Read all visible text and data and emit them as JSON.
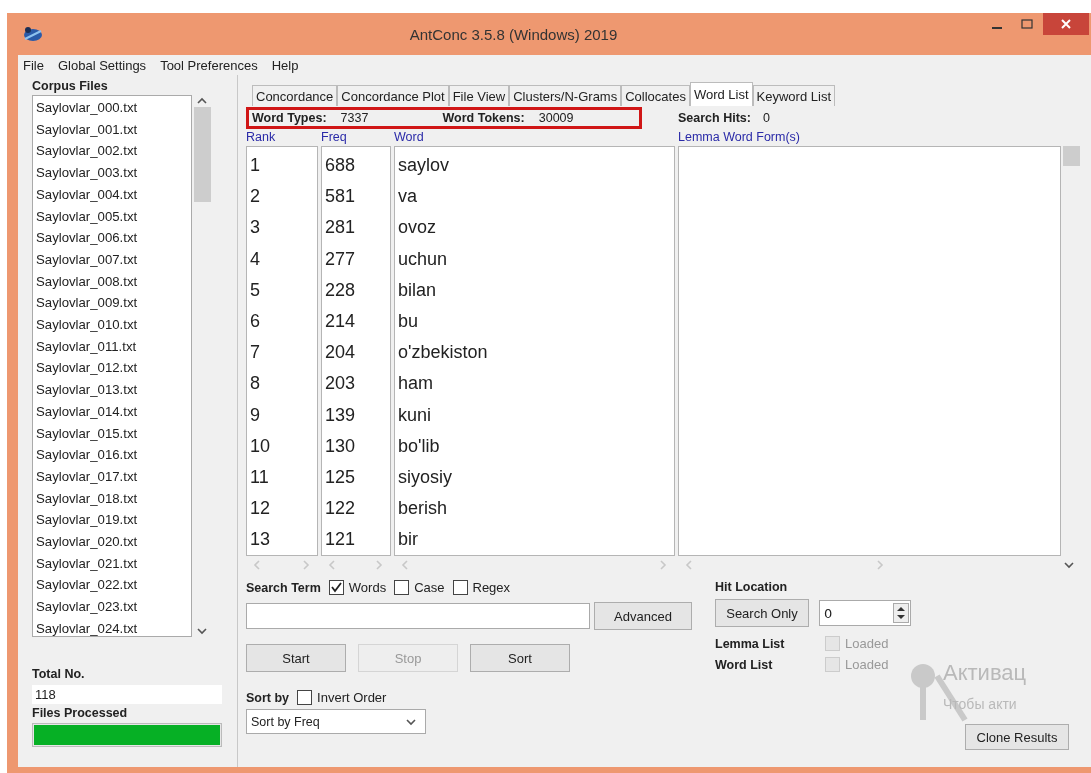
{
  "window": {
    "title": "AntConc 3.5.8 (Windows) 2019"
  },
  "menu": [
    "File",
    "Global Settings",
    "Tool Preferences",
    "Help"
  ],
  "corpus": {
    "label": "Corpus Files",
    "files": [
      "Saylovlar_000.txt",
      "Saylovlar_001.txt",
      "Saylovlar_002.txt",
      "Saylovlar_003.txt",
      "Saylovlar_004.txt",
      "Saylovlar_005.txt",
      "Saylovlar_006.txt",
      "Saylovlar_007.txt",
      "Saylovlar_008.txt",
      "Saylovlar_009.txt",
      "Saylovlar_010.txt",
      "Saylovlar_011.txt",
      "Saylovlar_012.txt",
      "Saylovlar_013.txt",
      "Saylovlar_014.txt",
      "Saylovlar_015.txt",
      "Saylovlar_016.txt",
      "Saylovlar_017.txt",
      "Saylovlar_018.txt",
      "Saylovlar_019.txt",
      "Saylovlar_020.txt",
      "Saylovlar_021.txt",
      "Saylovlar_022.txt",
      "Saylovlar_023.txt",
      "Saylovlar_024.txt"
    ],
    "total_label": "Total No.",
    "total": "118",
    "processed_label": "Files Processed",
    "progress": {
      "level": 1
    }
  },
  "tabs": [
    {
      "label": "Concordance",
      "selected": false
    },
    {
      "label": "Concordance Plot",
      "selected": false
    },
    {
      "label": "File View",
      "selected": false
    },
    {
      "label": "Clusters/N-Grams",
      "selected": false
    },
    {
      "label": "Collocates",
      "selected": false
    },
    {
      "label": "Word List",
      "selected": true
    },
    {
      "label": "Keyword List",
      "selected": false
    }
  ],
  "stats": {
    "word_types_label": "Word Types:",
    "word_types": "7337",
    "word_tokens_label": "Word Tokens:",
    "word_tokens": "30009",
    "search_hits_label": "Search Hits:",
    "search_hits": "0"
  },
  "table": {
    "columns": [
      "Rank",
      "Freq",
      "Word"
    ],
    "rows": [
      [
        "1",
        "688",
        "saylov"
      ],
      [
        "2",
        "581",
        "va"
      ],
      [
        "3",
        "281",
        "ovoz"
      ],
      [
        "4",
        "277",
        "uchun"
      ],
      [
        "5",
        "228",
        "bilan"
      ],
      [
        "6",
        "214",
        "bu"
      ],
      [
        "7",
        "204",
        "o'zbekiston"
      ],
      [
        "8",
        "203",
        "ham"
      ],
      [
        "9",
        "139",
        "kuni"
      ],
      [
        "10",
        "130",
        "bo'lib"
      ],
      [
        "11",
        "125",
        "siyosiy"
      ],
      [
        "12",
        "122",
        "berish"
      ],
      [
        "13",
        "121",
        "bir"
      ]
    ]
  },
  "lemma_panel": {
    "heading": "Lemma Word Form(s)"
  },
  "search": {
    "label": "Search Term",
    "options": [
      {
        "label": "Words",
        "checked": true
      },
      {
        "label": "Case",
        "checked": false
      },
      {
        "label": "Regex",
        "checked": false
      }
    ],
    "advanced": "Advanced"
  },
  "buttons": [
    {
      "label": "Start",
      "disabled": false
    },
    {
      "label": "Stop",
      "disabled": true
    },
    {
      "label": "Sort",
      "disabled": false
    }
  ],
  "sort": {
    "label": "Sort by",
    "invert": {
      "label": "Invert Order",
      "checked": false
    },
    "value": "Sort by Freq"
  },
  "hit_location": {
    "label": "Hit Location",
    "button": "Search Only",
    "value": "0"
  },
  "lists": [
    {
      "label": "Lemma List",
      "status": "Loaded",
      "checked": false,
      "disabled": true
    },
    {
      "label": "Word List",
      "status": "Loaded",
      "checked": false,
      "disabled": true
    }
  ],
  "clone_button": "Clone Results",
  "activation_notice": [
    "Активац",
    "Чтобы акти"
  ]
}
